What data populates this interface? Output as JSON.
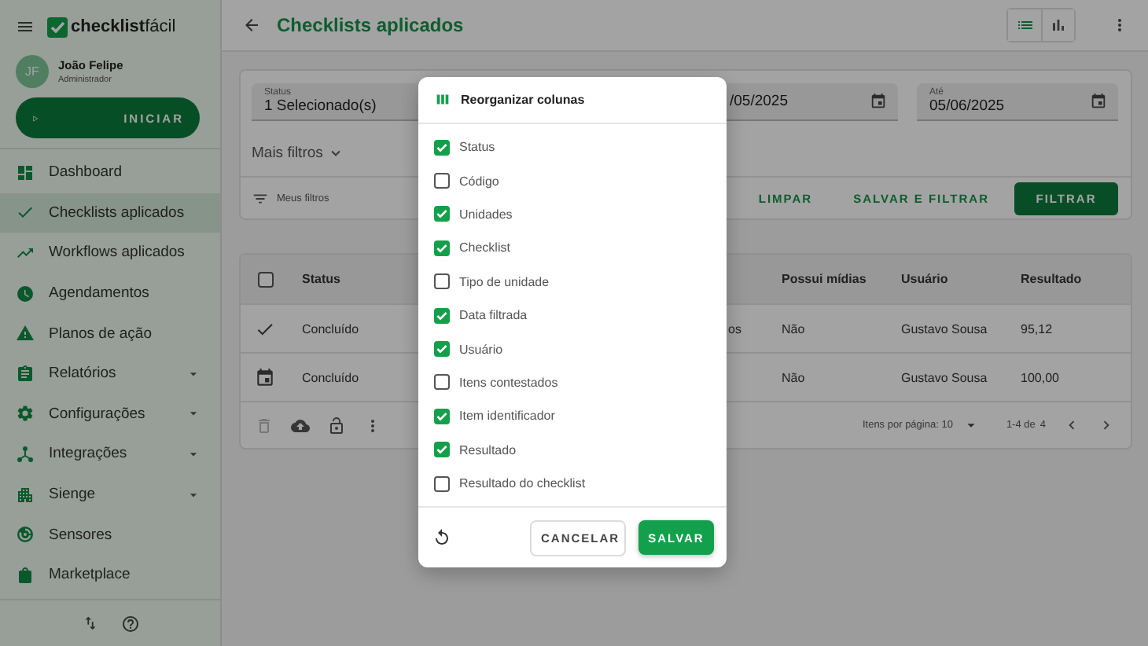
{
  "sidebar": {
    "brand": {
      "bold": "checklist",
      "light": "fácil"
    },
    "user": {
      "initials": "JF",
      "name": "João Felipe",
      "role": "Administrador"
    },
    "start_button": "INICIAR",
    "nav": [
      {
        "kind": "dashboard",
        "label": "Dashboard",
        "selected": false,
        "expandable": false
      },
      {
        "kind": "check",
        "label": "Checklists aplicados",
        "selected": true,
        "expandable": false
      },
      {
        "kind": "trend",
        "label": "Workflows aplicados",
        "selected": false,
        "expandable": false
      },
      {
        "kind": "clock",
        "label": "Agendamentos",
        "selected": false,
        "expandable": false
      },
      {
        "kind": "warning",
        "label": "Planos de ação",
        "selected": false,
        "expandable": false
      },
      {
        "kind": "clipboard",
        "label": "Relatórios",
        "selected": false,
        "expandable": true
      },
      {
        "kind": "gear",
        "label": "Configurações",
        "selected": false,
        "expandable": true
      },
      {
        "kind": "hub",
        "label": "Integrações",
        "selected": false,
        "expandable": true
      },
      {
        "kind": "building",
        "label": "Sienge",
        "selected": false,
        "expandable": true
      },
      {
        "kind": "radar",
        "label": "Sensores",
        "selected": false,
        "expandable": false
      },
      {
        "kind": "bag",
        "label": "Marketplace",
        "selected": false,
        "expandable": false
      }
    ]
  },
  "header": {
    "title": "Checklists aplicados",
    "views": [
      {
        "kind": "list",
        "selected": true
      },
      {
        "kind": "chart",
        "selected": false
      }
    ]
  },
  "filters": {
    "fields": [
      {
        "kind": "select",
        "label": "Status",
        "value": "1 Selecionado(s)"
      },
      {
        "kind": "date",
        "value": "/05/2025"
      },
      {
        "kind": "date",
        "label": "Até",
        "value": "05/06/2025"
      }
    ],
    "more_filters": "Mais filtros",
    "saved_filters": "Meus filtros",
    "buttons": [
      {
        "kind": "text",
        "label": "LIMPAR"
      },
      {
        "kind": "text",
        "label": "SALVAR E FILTRAR"
      },
      {
        "kind": "filled",
        "label": "FILTRAR"
      }
    ]
  },
  "table": {
    "select_all": {
      "checked": false
    },
    "columns": [
      "Status",
      "",
      "Possui mídias",
      "Usuário",
      "Resultado"
    ],
    "rows": [
      {
        "kind": "done",
        "cells": [
          "Concluído",
          "os",
          "Não",
          "Gustavo Sousa",
          "95,12"
        ]
      },
      {
        "kind": "scheduled",
        "cells": [
          "Concluído",
          "",
          "Não",
          "Gustavo Sousa",
          "100,00"
        ]
      }
    ],
    "actions": [
      {
        "kind": "delete",
        "disabled": true
      },
      {
        "kind": "upload",
        "disabled": false
      },
      {
        "kind": "lock",
        "disabled": false
      },
      {
        "kind": "more",
        "disabled": false
      }
    ],
    "per_page": "Itens por página: 10",
    "range": "1-4 de",
    "total": "4"
  },
  "dialog": {
    "title": "Reorganizar colunas",
    "columns": [
      {
        "label": "Status",
        "checked": true
      },
      {
        "label": "Código",
        "checked": false
      },
      {
        "label": "Unidades",
        "checked": true
      },
      {
        "label": "Checklist",
        "checked": true
      },
      {
        "label": "Tipo de unidade",
        "checked": false
      },
      {
        "label": "Data filtrada",
        "checked": true
      },
      {
        "label": "Usuário",
        "checked": true
      },
      {
        "label": "Itens contestados",
        "checked": false
      },
      {
        "label": "Item identificador",
        "checked": true
      },
      {
        "label": "Resultado",
        "checked": true
      },
      {
        "label": "Resultado do checklist",
        "checked": false
      }
    ],
    "buttons": [
      {
        "kind": "outlined",
        "label": "CANCELAR"
      },
      {
        "kind": "filled",
        "label": "SALVAR"
      }
    ]
  }
}
